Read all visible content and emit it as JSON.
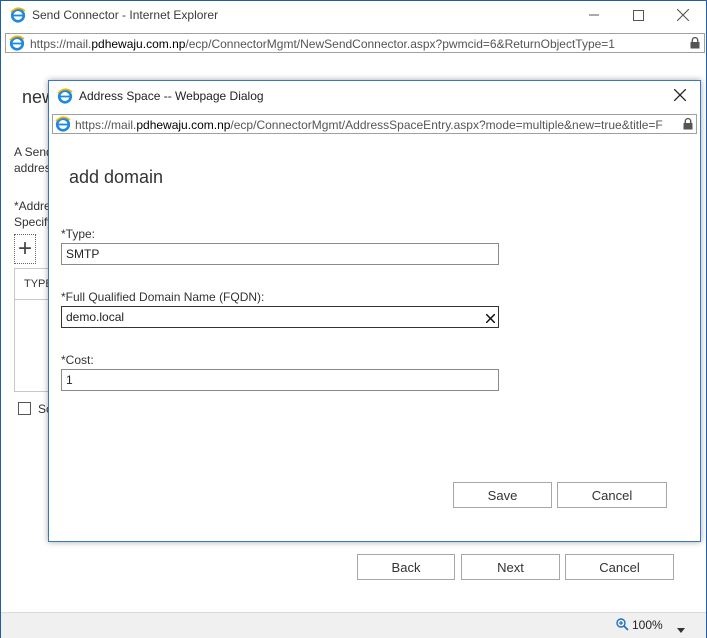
{
  "outer_window": {
    "title": "Send Connector - Internet Explorer",
    "url_prefix": "https://mail.",
    "url_domain": "pdhewaju.com.np",
    "url_path": "/ecp/ConnectorMgmt/NewSendConnector.aspx?pwmcid=6&ReturnObjectType=1"
  },
  "background_page": {
    "heading_partial": "new",
    "desc_line1": "A Send",
    "desc_line2": "addres",
    "addr_label1": "*Addre",
    "addr_label2": "Specify",
    "add_icon_glyph": "+",
    "table_header_type": "TYPE",
    "checkbox_label_partial": "Sc",
    "buttons": {
      "back": "Back",
      "next": "Next",
      "cancel": "Cancel"
    }
  },
  "status_bar": {
    "zoom": "100%"
  },
  "dialog": {
    "title": "Address Space -- Webpage Dialog",
    "url_prefix": "https://mail.",
    "url_domain": "pdhewaju.com.np",
    "url_path": "/ecp/ConnectorMgmt/AddressSpaceEntry.aspx?mode=multiple&new=true&title=F",
    "heading": "add domain",
    "type_label": "*Type:",
    "type_value": "SMTP",
    "fqdn_label": "*Full Qualified Domain Name (FQDN):",
    "fqdn_value": "demo.local",
    "cost_label": "*Cost:",
    "cost_value": "1",
    "save_label": "Save",
    "cancel_label": "Cancel"
  },
  "icons": {
    "ie": "ie-logo-icon",
    "lock": "lock-icon",
    "minimize": "minimize-icon",
    "maximize": "maximize-icon",
    "close": "close-icon",
    "clear": "clear-icon",
    "zoom": "zoom-icon",
    "dropdown": "chevron-down-icon"
  },
  "colors": {
    "ie_blue": "#1e88e5",
    "window_border": "#1e5ea8",
    "dialog_border": "#3a76c4"
  }
}
